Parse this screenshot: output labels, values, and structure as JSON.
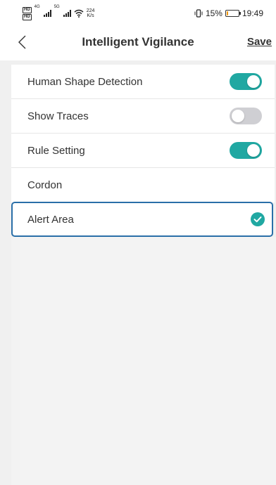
{
  "status_bar": {
    "hd_top": "HD",
    "hd_bottom": "HD",
    "sim1_label": "4G",
    "sim2_label": "5G",
    "speed_value": "224",
    "speed_unit": "K/s",
    "battery_percent": "15%",
    "battery_level": 0.15,
    "time": "19:49"
  },
  "navbar": {
    "title": "Intelligent Vigilance",
    "save_label": "Save",
    "back_icon": "chevron-left-icon"
  },
  "settings": [
    {
      "label": "Human Shape Detection",
      "control": "toggle",
      "on": true
    },
    {
      "label": "Show Traces",
      "control": "toggle",
      "on": false
    },
    {
      "label": "Rule Setting",
      "control": "toggle",
      "on": true
    },
    {
      "label": "Cordon",
      "control": "none"
    }
  ],
  "alert_area": {
    "label": "Alert Area",
    "selected": true,
    "icon": "check-circle-icon"
  },
  "colors": {
    "accent": "#20a8a2",
    "toggle_off": "#cfcfd3",
    "selected_border": "#2a6fa8",
    "battery_low": "#f39800"
  }
}
